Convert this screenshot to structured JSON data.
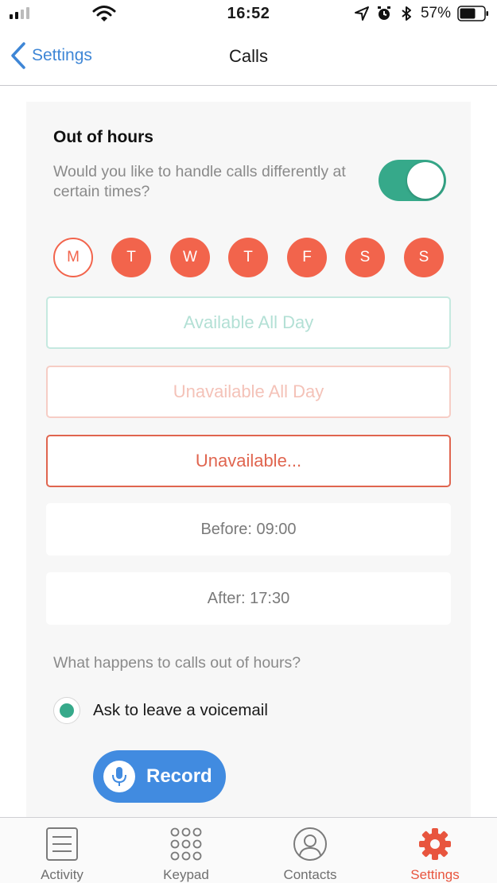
{
  "status_bar": {
    "time": "16:52",
    "battery_percent": "57%",
    "icons": [
      "signal-icon",
      "wifi-icon",
      "location-icon",
      "alarm-icon",
      "bluetooth-icon",
      "battery-icon"
    ]
  },
  "nav": {
    "back_label": "Settings",
    "title": "Calls"
  },
  "out_of_hours": {
    "title": "Out of hours",
    "description": "Would you like to handle calls differently at certain times?",
    "toggle_on": true,
    "days": [
      {
        "label": "M",
        "selected": true
      },
      {
        "label": "T",
        "selected": false
      },
      {
        "label": "W",
        "selected": false
      },
      {
        "label": "T",
        "selected": false
      },
      {
        "label": "F",
        "selected": false
      },
      {
        "label": "S",
        "selected": false
      },
      {
        "label": "S",
        "selected": false
      }
    ],
    "options": {
      "available": "Available All Day",
      "unavailable": "Unavailable All Day",
      "custom": "Unavailable..."
    },
    "before": "Before: 09:00",
    "after": "After: 17:30",
    "question": "What happens to calls out of hours?",
    "voicemail_label": "Ask to leave a voicemail",
    "record_label": "Record"
  },
  "tabs": [
    {
      "label": "Activity",
      "icon": "list-icon",
      "active": false
    },
    {
      "label": "Keypad",
      "icon": "keypad-icon",
      "active": false
    },
    {
      "label": "Contacts",
      "icon": "contacts-icon",
      "active": false
    },
    {
      "label": "Settings",
      "icon": "gear-icon",
      "active": true
    }
  ],
  "colors": {
    "accent_blue": "#418be0",
    "teal": "#36a98a",
    "coral": "#f2644c",
    "active_tab": "#e8553e"
  }
}
